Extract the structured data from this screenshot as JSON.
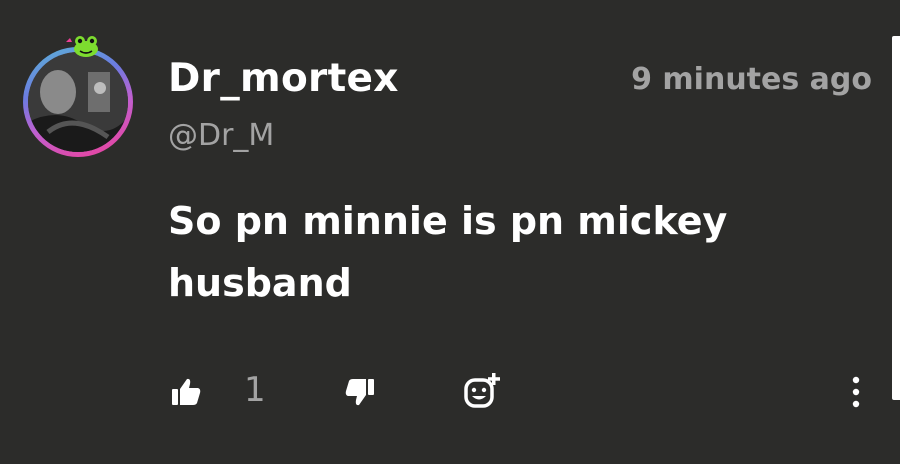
{
  "comment": {
    "author": "Dr_mortex",
    "handle": "@Dr_M",
    "timestamp": "9 minutes ago",
    "text": "So pn minnie is pn mickey husband",
    "likes": "1"
  },
  "icons": {
    "like": "thumbs-up-icon",
    "dislike": "thumbs-down-icon",
    "react": "add-emoji-reaction-icon",
    "more": "more-vertical-icon",
    "badge": "frog-badge-icon"
  },
  "colors": {
    "background": "#2c2c2a",
    "primary_text": "#ffffff",
    "secondary_text": "#a3a3a3",
    "avatar_ring_start": "#5ab6d6",
    "avatar_ring_end": "#ee3f96",
    "badge_green": "#7ddc2f"
  }
}
